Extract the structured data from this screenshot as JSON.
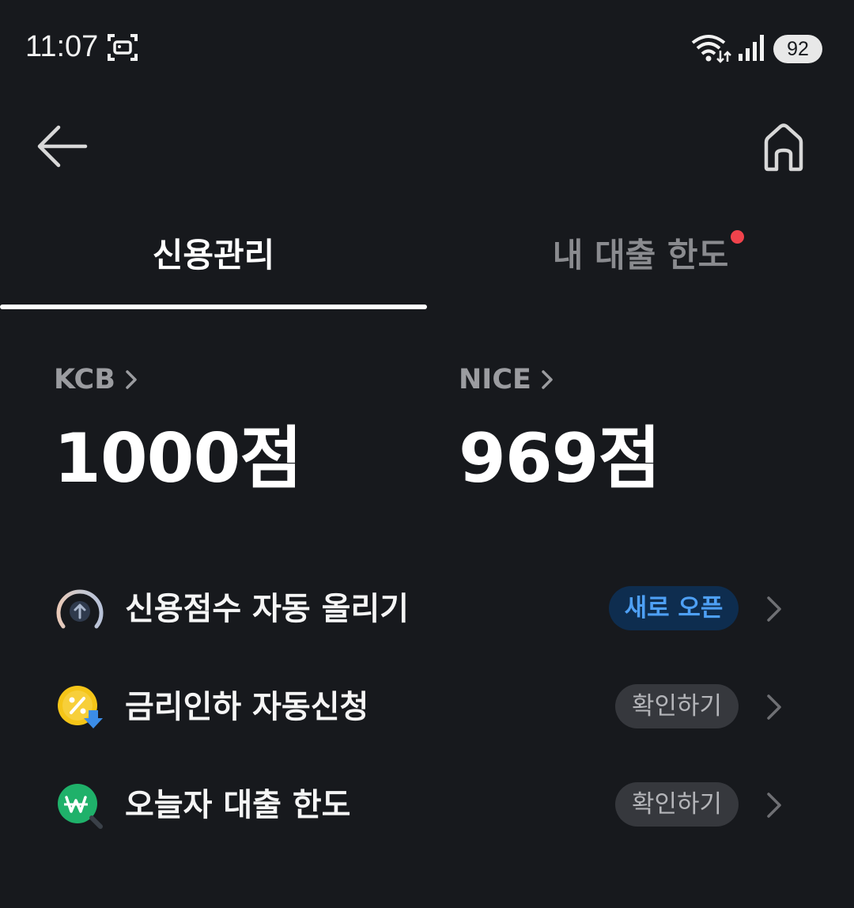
{
  "status_bar": {
    "time": "11:07",
    "battery": "92"
  },
  "tabs": [
    {
      "label": "신용관리",
      "active": true
    },
    {
      "label": "내 대출 한도",
      "active": false,
      "has_notification_dot": true
    }
  ],
  "scores": [
    {
      "agency": "KCB",
      "value": "1000점"
    },
    {
      "agency": "NICE",
      "value": "969점"
    }
  ],
  "services": [
    {
      "label": "신용점수 자동 올리기",
      "badge": "새로 오픈",
      "icon": "gauge-up-icon"
    },
    {
      "label": "금리인하 자동신청",
      "badge": "확인하기",
      "icon": "rate-discount-icon"
    },
    {
      "label": "오늘자 대출 한도",
      "badge": "확인하기",
      "icon": "won-search-icon"
    }
  ],
  "colors": {
    "background": "#17191d",
    "accent_blue": "#4ea0f5",
    "notification_red": "#f0434c",
    "coin_yellow": "#f5c518",
    "won_green": "#1fb16a"
  }
}
